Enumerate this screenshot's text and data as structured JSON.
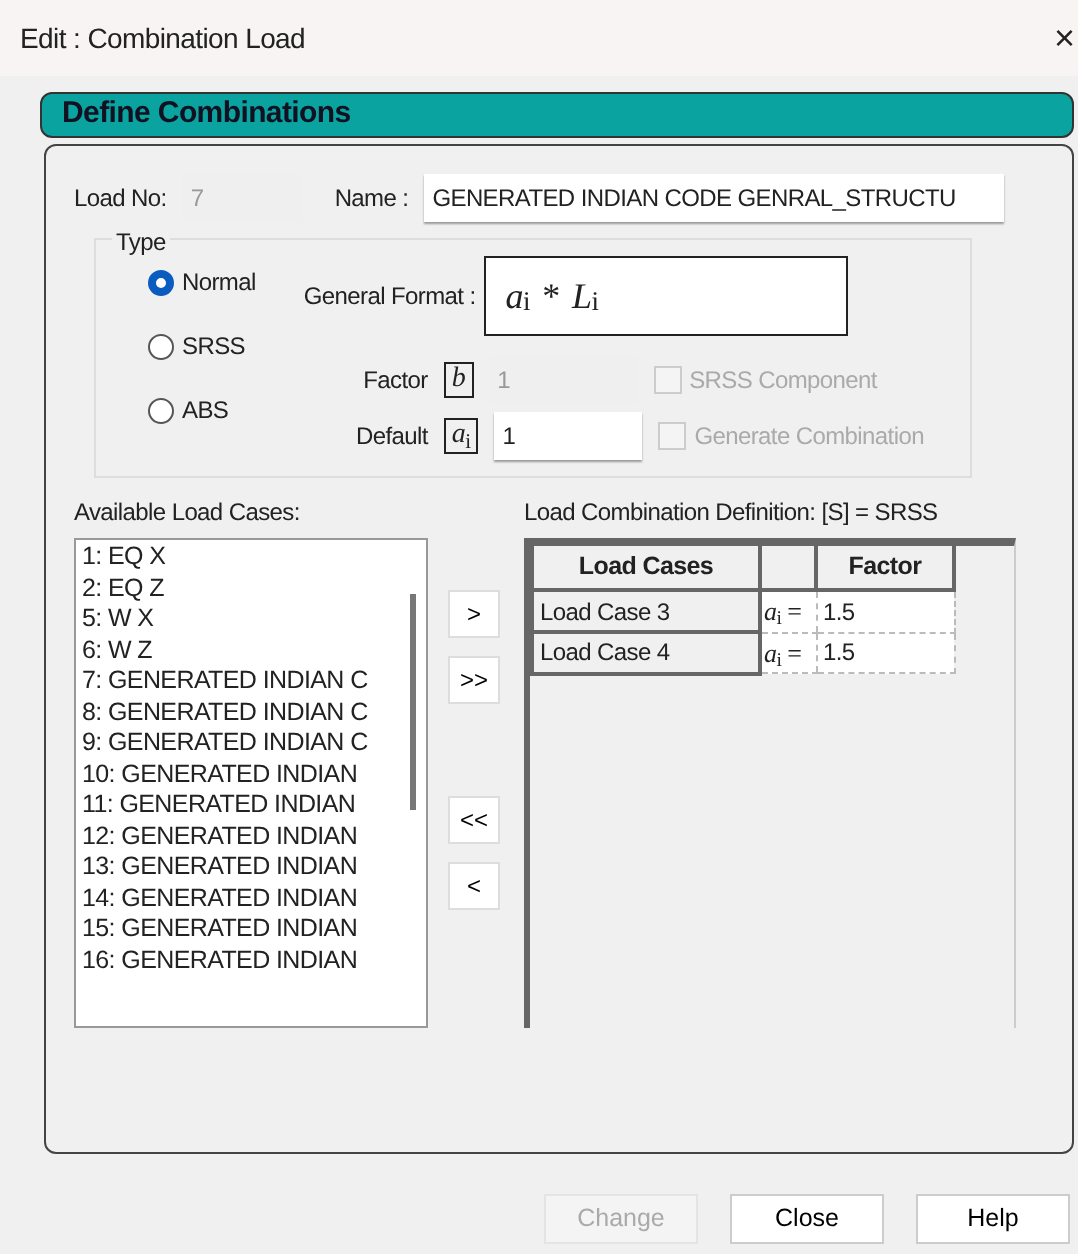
{
  "window": {
    "title": "Edit : Combination Load",
    "close": "×"
  },
  "header": "Define Combinations",
  "load_no": {
    "label": "Load No:",
    "value": "7",
    "disabled": true
  },
  "name": {
    "label": "Name :",
    "value": "GENERATED INDIAN CODE GENRAL_STRUCTU"
  },
  "type": {
    "label": "Type",
    "options": [
      {
        "label": "Normal",
        "selected": true
      },
      {
        "label": "SRSS",
        "selected": false
      },
      {
        "label": "ABS",
        "selected": false
      }
    ]
  },
  "general_format": {
    "label": "General Format :",
    "formula": "*a*$_{i}$ * *L*$_{i}$"
  },
  "fields": [
    {
      "label": "Factor",
      "symbol": "*b*",
      "value": "1",
      "disabled": true
    },
    {
      "label": "Default",
      "symbol": "*a*$_{i}$",
      "value": "1",
      "disabled": false
    }
  ],
  "checkboxes": [
    {
      "label": "SRSS Component",
      "checked": false,
      "disabled": true
    },
    {
      "label": "Generate Combination",
      "checked": false,
      "disabled": true
    }
  ],
  "available": {
    "label": "Available Load Cases:",
    "items": [
      "1: EQ X",
      "2: EQ Z",
      "5: W X",
      "6: W Z",
      "7: GENERATED INDIAN C",
      "8: GENERATED INDIAN C",
      "9: GENERATED INDIAN C",
      "10: GENERATED INDIAN",
      "11: GENERATED INDIAN",
      "12: GENERATED INDIAN",
      "13: GENERATED INDIAN",
      "14: GENERATED INDIAN",
      "15: GENERATED INDIAN",
      "16: GENERATED INDIAN"
    ]
  },
  "move_buttons": [
    ">",
    ">>",
    "<<",
    "<"
  ],
  "definition": {
    "label": "Load Combination Definition:  [S] = SRSS",
    "columns": [
      "Load Cases",
      "Factor"
    ],
    "rows": [
      {
        "load_case": "Load Case 3",
        "symbol": "*a*$_{i}$ =",
        "factor": "1.5"
      },
      {
        "load_case": "Load Case 4",
        "symbol": "*a*$_{i}$ =",
        "factor": "1.5"
      }
    ]
  },
  "buttons": [
    {
      "label": "Change",
      "disabled": true
    },
    {
      "label": "Close",
      "disabled": false
    },
    {
      "label": "Help",
      "disabled": false
    }
  ]
}
